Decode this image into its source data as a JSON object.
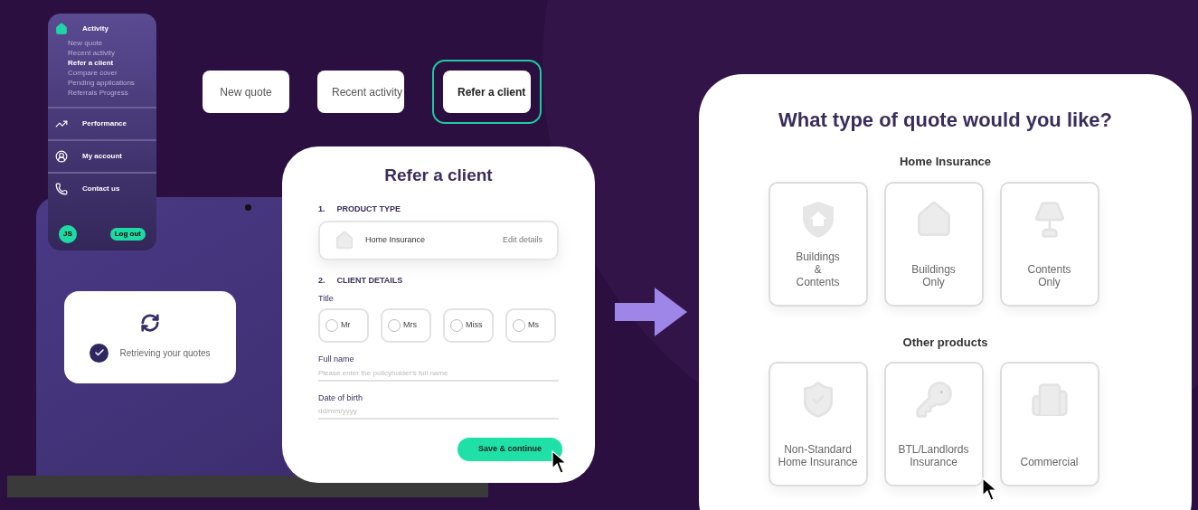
{
  "sidebar": {
    "sections": [
      {
        "label": "Activity",
        "children": [
          {
            "label": "New quote",
            "selected": false
          },
          {
            "label": "Recent activity",
            "selected": false
          },
          {
            "label": "Refer a client",
            "selected": true
          },
          {
            "label": "Compare cover",
            "selected": false
          },
          {
            "label": "Pending applications",
            "selected": false
          },
          {
            "label": "Referrals Progress",
            "selected": false
          }
        ]
      },
      {
        "label": "Performance"
      },
      {
        "label": "My account"
      },
      {
        "label": "Contact us"
      }
    ],
    "initials": "JS",
    "logout": "Log out"
  },
  "top_buttons": [
    {
      "label": "New quote",
      "selected": false
    },
    {
      "label": "Recent activity",
      "selected": false
    },
    {
      "label": "Refer a client",
      "selected": true
    }
  ],
  "status_card": {
    "message": "Retrieving your quotes",
    "checked": true
  },
  "form": {
    "title": "Refer a client",
    "product_section": {
      "number": "1.",
      "heading": "PRODUCT TYPE",
      "product": "Home Insurance",
      "action": "Edit details"
    },
    "client_section": {
      "number": "2.",
      "heading": "CLIENT DETAILS",
      "title_label": "Title",
      "titles": [
        {
          "label": "Mr",
          "selected": false
        },
        {
          "label": "Mrs",
          "selected": false
        },
        {
          "label": "Miss",
          "selected": false
        },
        {
          "label": "Ms",
          "selected": false
        }
      ],
      "fields": [
        {
          "label": "Full name",
          "placeholder": "Please enter the policyholder's full name"
        },
        {
          "label": "Date of birth",
          "placeholder": "dd/mm/yyyy"
        }
      ]
    },
    "button": "Save & continue"
  },
  "quote_panel": {
    "title": "What type of quote would you like?",
    "groups": [
      {
        "heading": "Home Insurance",
        "options": [
          {
            "label": "Buildings\n&\nContents"
          },
          {
            "label": "Buildings\nOnly"
          },
          {
            "label": "Contents\nOnly"
          }
        ]
      },
      {
        "heading": "Other products",
        "options": [
          {
            "label": "Non-Standard\nHome Insurance"
          },
          {
            "label": "BTL/Landlords\nInsurance"
          },
          {
            "label": "Commercial"
          }
        ]
      }
    ]
  }
}
